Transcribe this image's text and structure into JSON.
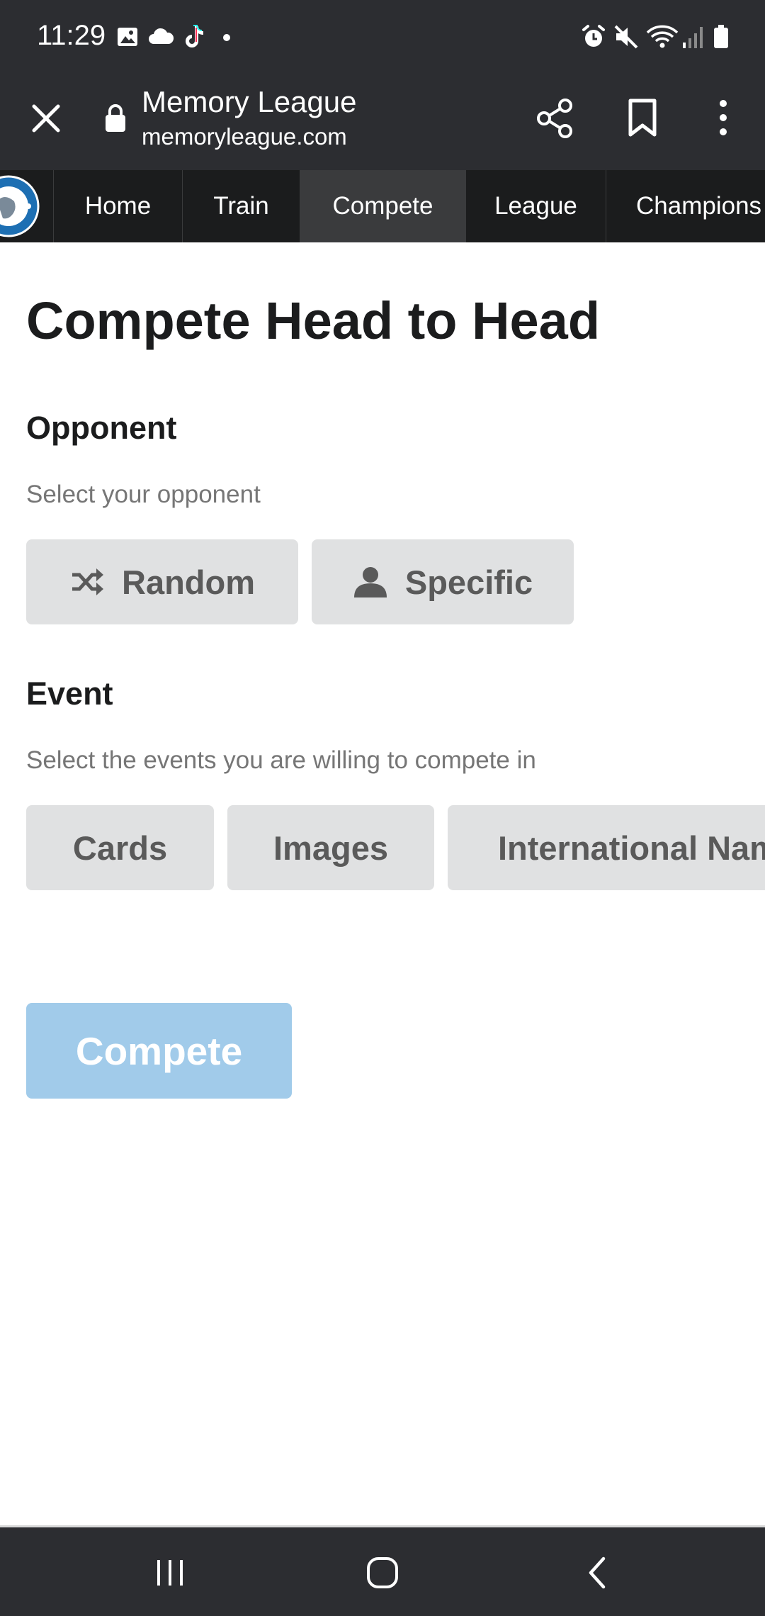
{
  "status_bar": {
    "time": "11:29",
    "left_icons": [
      "gallery-icon",
      "cloud-icon",
      "tiktok-icon",
      "dot-icon"
    ],
    "right_icons": [
      "alarm-icon",
      "mute-icon",
      "wifi-icon",
      "signal-icon",
      "battery-icon"
    ]
  },
  "browser": {
    "title": "Memory League",
    "url": "memoryleague.com"
  },
  "nav": {
    "logo_alt": "Memory League",
    "items": [
      {
        "label": "Home",
        "active": false
      },
      {
        "label": "Train",
        "active": false
      },
      {
        "label": "Compete",
        "active": true
      },
      {
        "label": "League",
        "active": false
      },
      {
        "label": "Champions",
        "active": false
      }
    ]
  },
  "main": {
    "title": "Compete Head to Head",
    "opponent": {
      "heading": "Opponent",
      "hint": "Select your opponent",
      "options": [
        {
          "label": "Random",
          "icon": "shuffle-icon"
        },
        {
          "label": "Specific",
          "icon": "user-icon"
        }
      ]
    },
    "event": {
      "heading": "Event",
      "hint": "Select the events you are willing to compete in",
      "options": [
        "Cards",
        "Images",
        "International Names"
      ]
    },
    "compete_button": "Compete"
  },
  "colors": {
    "bars": "#2c2d31",
    "site_nav": "#1b1c1d",
    "active_nav": "#3a3b3d",
    "choice_bg": "#e0e1e2",
    "compete_disabled": "#a1cbea"
  }
}
